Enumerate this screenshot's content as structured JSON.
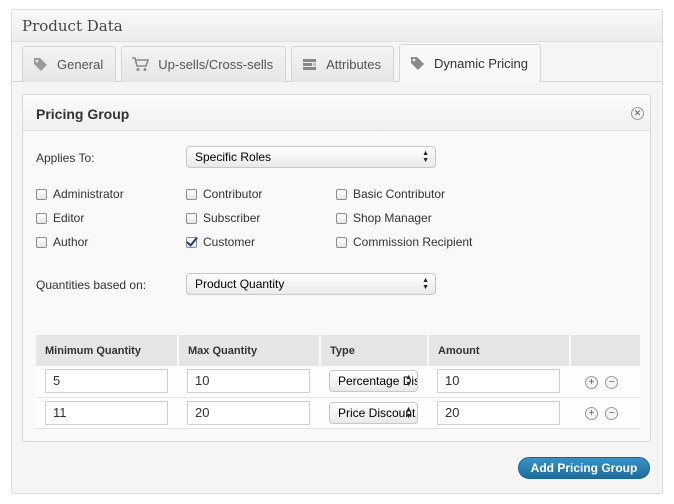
{
  "panel": {
    "title": "Product Data"
  },
  "tabs": [
    {
      "label": "General",
      "icon": "tag-icon"
    },
    {
      "label": "Up-sells/Cross-sells",
      "icon": "cart-icon"
    },
    {
      "label": "Attributes",
      "icon": "attributes-icon"
    },
    {
      "label": "Dynamic Pricing",
      "icon": "tag-icon",
      "active": true
    }
  ],
  "group": {
    "title": "Pricing Group",
    "applies_to": {
      "label": "Applies To:",
      "value": "Specific Roles"
    },
    "roles": [
      {
        "label": "Administrator",
        "checked": false
      },
      {
        "label": "Contributor",
        "checked": false
      },
      {
        "label": "Basic Contributor",
        "checked": false
      },
      {
        "label": "Editor",
        "checked": false
      },
      {
        "label": "Subscriber",
        "checked": false
      },
      {
        "label": "Shop Manager",
        "checked": false
      },
      {
        "label": "Author",
        "checked": false
      },
      {
        "label": "Customer",
        "checked": true
      },
      {
        "label": "Commission Recipient",
        "checked": false
      }
    ],
    "quantities": {
      "label": "Quantities based on:",
      "value": "Product Quantity"
    },
    "table": {
      "headers": [
        "Minimum Quantity",
        "Max Quantity",
        "Type",
        "Amount"
      ],
      "rows": [
        {
          "min": "5",
          "max": "10",
          "type": "Percentage Discount",
          "amount": "10"
        },
        {
          "min": "11",
          "max": "20",
          "type": "Price Discount",
          "amount": "20"
        }
      ]
    }
  },
  "add_button": {
    "label": "Add Pricing Group"
  },
  "colors": {
    "accent": "#2a7fb2",
    "header_bg": "#e5e5e5"
  }
}
